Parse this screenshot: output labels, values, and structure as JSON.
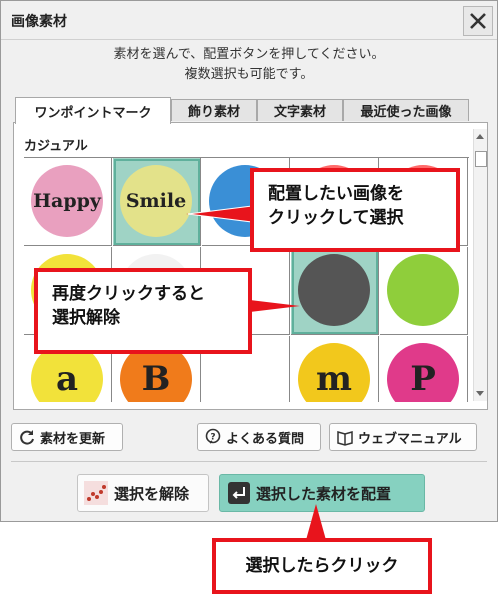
{
  "dialog": {
    "title": "画像素材",
    "instructions_line1": "素材を選んで、配置ボタンを押してください。",
    "instructions_line2": "複数選択も可能です。"
  },
  "tabs": [
    {
      "label": "ワンポイントマーク",
      "active": true
    },
    {
      "label": "飾り素材",
      "active": false
    },
    {
      "label": "文字素材",
      "active": false
    },
    {
      "label": "最近使った画像",
      "active": false
    }
  ],
  "panel": {
    "category_label": "カジュアル",
    "items": [
      {
        "text": "Happy",
        "bg": "#e9a0bf"
      },
      {
        "text": "Smile",
        "bg": "#e3e28a",
        "selected": true
      },
      {
        "text": "",
        "bg": "#3a8fd6"
      },
      {
        "text": "",
        "bg": "#ff6a6a"
      },
      {
        "text": "",
        "bg": "#ff6a6a"
      },
      {
        "text": "",
        "bg": "#f2e23a"
      },
      {
        "text": "",
        "bg": "#f2f2f2"
      },
      {
        "text": "",
        "bg": "#ffffff"
      },
      {
        "text": "",
        "bg": "#555555",
        "selected": true
      },
      {
        "text": "",
        "bg": "#8fce3b"
      },
      {
        "text": "a",
        "bg": "#f2e23a"
      },
      {
        "text": "B",
        "bg": "#f07b1b"
      },
      {
        "text": "",
        "bg": "#ffffff"
      },
      {
        "text": "m",
        "bg": "#f2c81c"
      },
      {
        "text": "P",
        "bg": "#e03a8a"
      }
    ]
  },
  "buttons": {
    "refresh": "素材を更新",
    "faq": "よくある質問",
    "manual": "ウェブマニュアル",
    "deselect": "選択を解除",
    "place": "選択した素材を配置"
  },
  "callouts": {
    "place_tip_line1": "配置したい画像を",
    "place_tip_line2": "クリックして選択",
    "deselect_tip_line1": "再度クリックすると",
    "deselect_tip_line2": "選択解除",
    "click_tip": "選択したらクリック"
  },
  "colors": {
    "accent_green": "#86d1c0",
    "callout_red": "#e8141c"
  }
}
